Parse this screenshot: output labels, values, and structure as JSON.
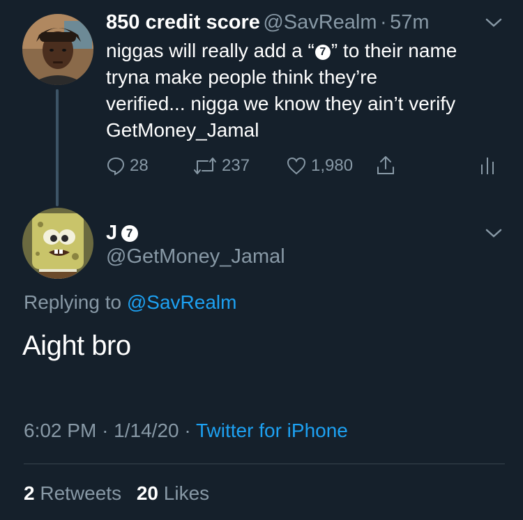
{
  "tweet1": {
    "name": "850 credit score",
    "handle": "@SavRealm",
    "sep": "·",
    "time": "57m",
    "line1_pre": "niggas will really add a “",
    "emoji": "7",
    "line1_post": "” to their name",
    "line2": "tryna make people think they’re",
    "line3": "verified... nigga we know they ain’t verify",
    "line4": "GetMoney_Jamal",
    "replies": "28",
    "retweets": "237",
    "likes": "1,980"
  },
  "tweet2": {
    "name": "J",
    "emoji": "7",
    "handle": "@GetMoney_Jamal",
    "replying_prefix": "Replying to",
    "replying_handle": "@SavRealm",
    "text": "Aight bro",
    "time": "6:02 PM",
    "date": "1/14/20",
    "sep": "·",
    "source": "Twitter for iPhone"
  },
  "stats": {
    "retweets_count": "2",
    "retweets_label": "Retweets",
    "likes_count": "20",
    "likes_label": "Likes"
  },
  "colors": {
    "background": "#15202b",
    "accent": "#1da1f2",
    "muted": "#8899a6"
  }
}
